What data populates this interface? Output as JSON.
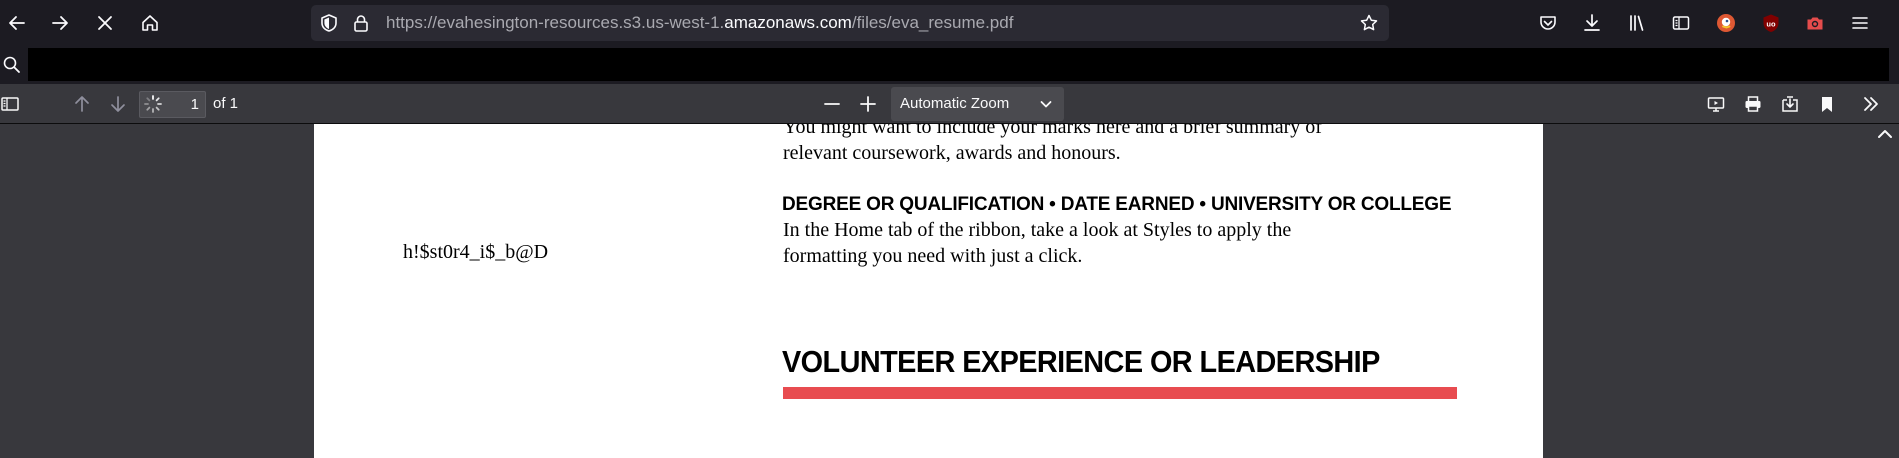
{
  "browser": {
    "url_prefix": "https://evahesington-resources.s3.us-west-1.",
    "url_domain": "amazonaws.com",
    "url_path": "/files/eva_resume.pdf",
    "icons": [
      "back-arrow",
      "forward-arrow",
      "stop-x",
      "home",
      "tracking-shield",
      "lock",
      "bookmark-star",
      "pocket",
      "downloads",
      "library",
      "sidebar",
      "duckduckgo",
      "ublock-origin",
      "screenshot-camera",
      "menu-hamburger"
    ]
  },
  "find_bar": {
    "value": "",
    "placeholder": ""
  },
  "pdf_toolbar": {
    "page_number": "1",
    "page_count": "of 1",
    "zoom": "Automatic Zoom"
  },
  "document": {
    "summary_line1": "You might want to include your marks here and a brief summary of",
    "summary_line2": "relevant coursework, awards and honours.",
    "degree_heading": "DEGREE OR QUALIFICATION  •  DATE EARNED  •  UNIVERSITY OR COLLEGE",
    "body_line1": "In the Home tab of the ribbon, take a look at Styles to apply the",
    "body_line2": "formatting you need with just a click.",
    "side_note": "h!$st0r4_i$_b@D",
    "section_heading": "VOLUNTEER EXPERIENCE OR LEADERSHIP",
    "accent_color": "#e84c50"
  }
}
